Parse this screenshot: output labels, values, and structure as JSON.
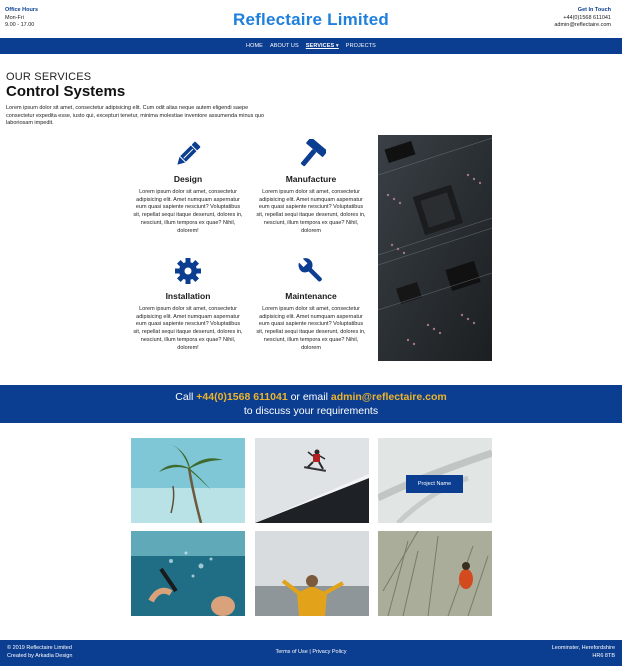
{
  "header": {
    "office_heading": "Office Hours",
    "office_days": "Mon-Fri",
    "office_times": "9.00 - 17.00",
    "logo": "Reflectaire Limited",
    "contact_heading": "Get In Touch",
    "contact_phone": "+44(0)1568 611041",
    "contact_email": "admin@reflectaire.com"
  },
  "nav": {
    "items": [
      "HOME",
      "ABOUT US",
      "SERVICES ▾",
      "PROJECTS"
    ]
  },
  "intro": {
    "kicker": "OUR SERVICES",
    "title": "Control Systems",
    "paragraph": "Lorem ipsum dolor sit amet, consectetur adipisicing elit. Cum odit alias neque autem eligendi saepe consectetur expedita esse, iusto qui, excepturi tenetur, minima molestiae inventore assumenda minus quo laboriosam impedit."
  },
  "services": [
    {
      "name": "Design",
      "icon": "pencil-icon",
      "desc": "Lorem ipsum dolor sit amet, consectetur adipisicing elit. Amet numquam aspernatur eum quasi sapiente nesciunt? Voluptatibus sit, repellat sequi itaque deserunt, dolores in, nesciunt, illum tempora ex quae? Nihil, dolorem!"
    },
    {
      "name": "Manufacture",
      "icon": "hammer-icon",
      "desc": "Lorem ipsum dolor sit amet, consectetur adipisicing elit. Amet numquam aspernatur eum quasi sapiente nesciunt? Voluptatibus sit, repellat sequi itaque deserunt, dolores in, nesciunt, illum tempora ex quae? Nihil, dolorem"
    },
    {
      "name": "Installation",
      "icon": "gear-icon",
      "desc": "Lorem ipsum dolor sit amet, consectetur adipisicing elit. Amet numquam aspernatur eum quasi sapiente nesciunt? Voluptatibus sit, repellat sequi itaque deserunt, dolores in, nesciunt, illum tempora ex quae? Nihil, dolorem!"
    },
    {
      "name": "Maintenance",
      "icon": "wrench-icon",
      "desc": "Lorem ipsum dolor sit amet, consectetur adipisicing elit. Amet numquam aspernatur eum quasi sapiente nesciunt? Voluptatibus sit, repellat sequi itaque deserunt, dolores in, nesciunt, illum tempora ex quae? Nihil, dolorem"
    }
  ],
  "cta": {
    "prefix": "Call ",
    "phone": "+44(0)1568 611041",
    "middle": " or email ",
    "email": "admin@reflectaire.com",
    "line2": "to discuss your requirements"
  },
  "gallery": {
    "overlay_label": "Project Name"
  },
  "footer": {
    "copyright": "© 2019 Reflectaire Limited",
    "credit": "Created by Arkadia Design",
    "links": "Terms of Use | Privacy Policy",
    "location": "Leominster, Herefordshire",
    "postcode": "HR6 8TB"
  },
  "colors": {
    "brand_blue": "#0b3d91",
    "logo_blue": "#1f7fdc",
    "highlight": "#f0b429"
  }
}
